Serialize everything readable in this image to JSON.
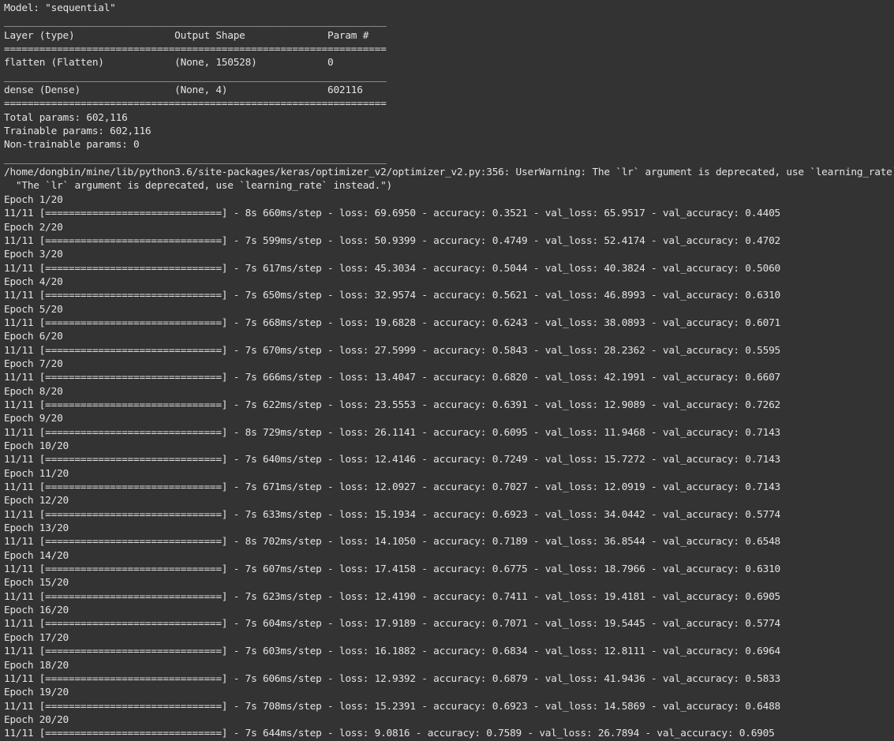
{
  "terminal": {
    "lines": [
      "Model: \"sequential\"",
      "_________________________________________________________________",
      "Layer (type)                 Output Shape              Param #",
      "=================================================================",
      "flatten (Flatten)            (None, 150528)            0",
      "_________________________________________________________________",
      "dense (Dense)                (None, 4)                 602116",
      "=================================================================",
      "Total params: 602,116",
      "Trainable params: 602,116",
      "Non-trainable params: 0",
      "_________________________________________________________________",
      "/home/dongbin/mine/lib/python3.6/site-packages/keras/optimizer_v2/optimizer_v2.py:356: UserWarning: The `lr` argument is deprecated, use `learning_rate` instead.",
      "  \"The `lr` argument is deprecated, use `learning_rate` instead.\")",
      "Epoch 1/20",
      "11/11 [==============================] - 8s 660ms/step - loss: 69.6950 - accuracy: 0.3521 - val_loss: 65.9517 - val_accuracy: 0.4405",
      "Epoch 2/20",
      "11/11 [==============================] - 7s 599ms/step - loss: 50.9399 - accuracy: 0.4749 - val_loss: 52.4174 - val_accuracy: 0.4702",
      "Epoch 3/20",
      "11/11 [==============================] - 7s 617ms/step - loss: 45.3034 - accuracy: 0.5044 - val_loss: 40.3824 - val_accuracy: 0.5060",
      "Epoch 4/20",
      "11/11 [==============================] - 7s 650ms/step - loss: 32.9574 - accuracy: 0.5621 - val_loss: 46.8993 - val_accuracy: 0.6310",
      "Epoch 5/20",
      "11/11 [==============================] - 7s 668ms/step - loss: 19.6828 - accuracy: 0.6243 - val_loss: 38.0893 - val_accuracy: 0.6071",
      "Epoch 6/20",
      "11/11 [==============================] - 7s 670ms/step - loss: 27.5999 - accuracy: 0.5843 - val_loss: 28.2362 - val_accuracy: 0.5595",
      "Epoch 7/20",
      "11/11 [==============================] - 7s 666ms/step - loss: 13.4047 - accuracy: 0.6820 - val_loss: 42.1991 - val_accuracy: 0.6607",
      "Epoch 8/20",
      "11/11 [==============================] - 7s 622ms/step - loss: 23.5553 - accuracy: 0.6391 - val_loss: 12.9089 - val_accuracy: 0.7262",
      "Epoch 9/20",
      "11/11 [==============================] - 8s 729ms/step - loss: 26.1141 - accuracy: 0.6095 - val_loss: 11.9468 - val_accuracy: 0.7143",
      "Epoch 10/20",
      "11/11 [==============================] - 7s 640ms/step - loss: 12.4146 - accuracy: 0.7249 - val_loss: 15.7272 - val_accuracy: 0.7143",
      "Epoch 11/20",
      "11/11 [==============================] - 7s 671ms/step - loss: 12.0927 - accuracy: 0.7027 - val_loss: 12.0919 - val_accuracy: 0.7143",
      "Epoch 12/20",
      "11/11 [==============================] - 7s 633ms/step - loss: 15.1934 - accuracy: 0.6923 - val_loss: 34.0442 - val_accuracy: 0.5774",
      "Epoch 13/20",
      "11/11 [==============================] - 8s 702ms/step - loss: 14.1050 - accuracy: 0.7189 - val_loss: 36.8544 - val_accuracy: 0.6548",
      "Epoch 14/20",
      "11/11 [==============================] - 7s 607ms/step - loss: 17.4158 - accuracy: 0.6775 - val_loss: 18.7966 - val_accuracy: 0.6310",
      "Epoch 15/20",
      "11/11 [==============================] - 7s 623ms/step - loss: 12.4190 - accuracy: 0.7411 - val_loss: 19.4181 - val_accuracy: 0.6905",
      "Epoch 16/20",
      "11/11 [==============================] - 7s 604ms/step - loss: 17.9189 - accuracy: 0.7071 - val_loss: 19.5445 - val_accuracy: 0.5774",
      "Epoch 17/20",
      "11/11 [==============================] - 7s 603ms/step - loss: 16.1882 - accuracy: 0.6834 - val_loss: 12.8111 - val_accuracy: 0.6964",
      "Epoch 18/20",
      "11/11 [==============================] - 7s 606ms/step - loss: 12.9392 - accuracy: 0.6879 - val_loss: 41.9436 - val_accuracy: 0.5833",
      "Epoch 19/20",
      "11/11 [==============================] - 7s 708ms/step - loss: 15.2391 - accuracy: 0.6923 - val_loss: 14.5869 - val_accuracy: 0.6488",
      "Epoch 20/20",
      "11/11 [==============================] - 7s 644ms/step - loss: 9.0816 - accuracy: 0.7589 - val_loss: 26.7894 - val_accuracy: 0.6905"
    ]
  }
}
